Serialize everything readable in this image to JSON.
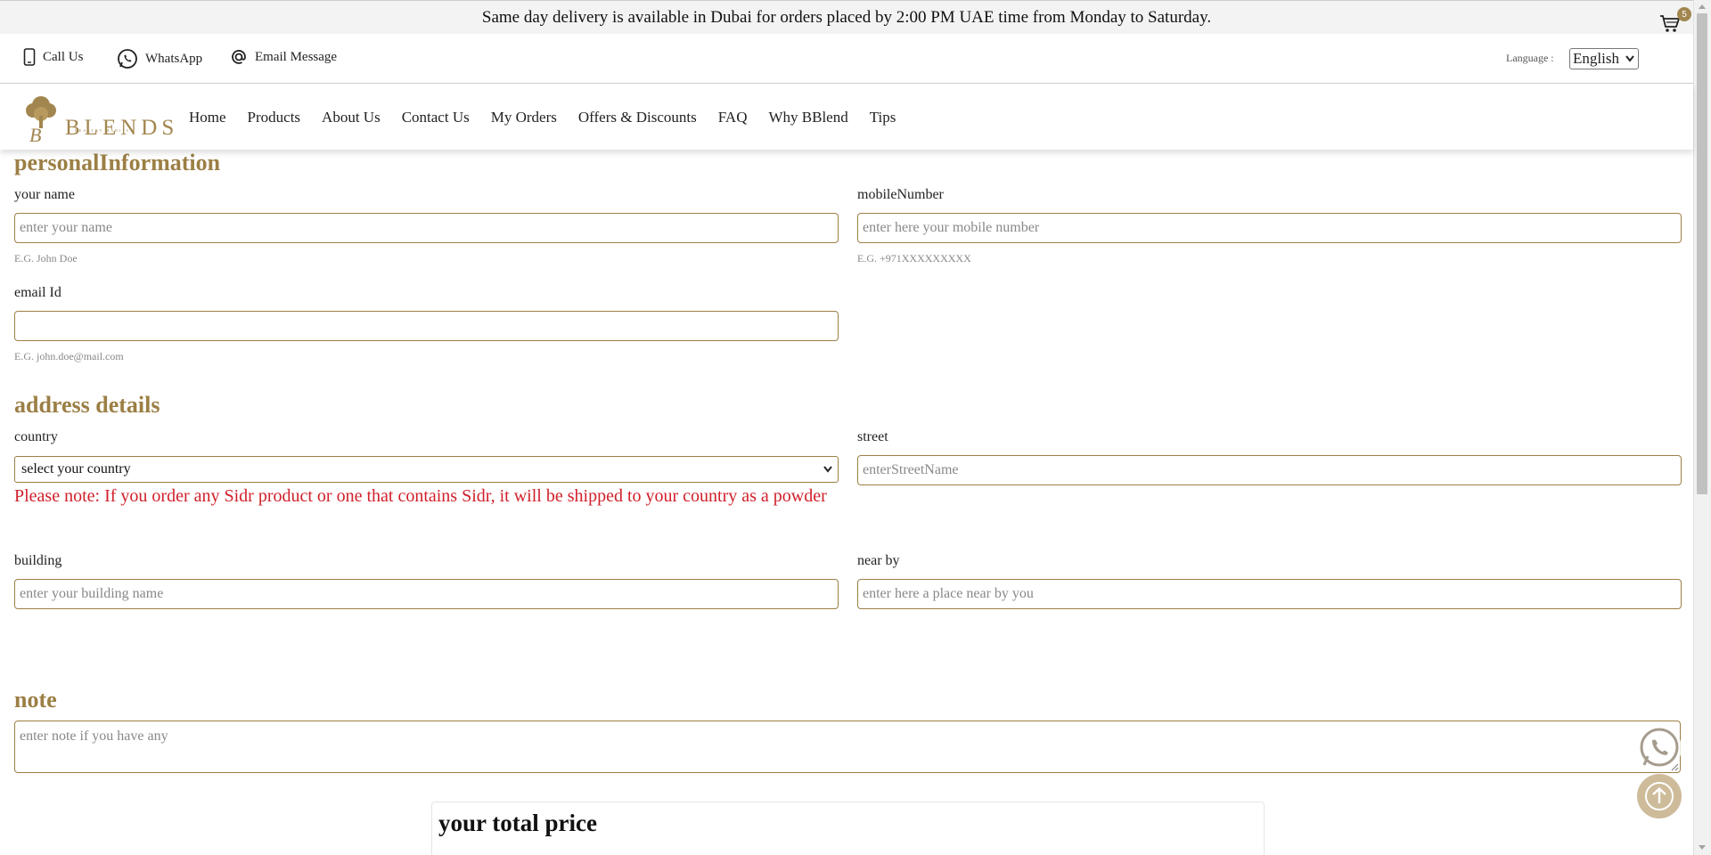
{
  "banner": {
    "text": "Same day delivery is available in Dubai for orders placed by 2:00 PM UAE time from Monday to Saturday."
  },
  "topbar": {
    "call": "Call Us",
    "whatsapp": "WhatsApp",
    "email": "Email Message",
    "language_label": "Language :",
    "language_value": "English",
    "cart_count": "5"
  },
  "logo": {
    "name": "BLENDS",
    "sub": "HEALTHY HABITS"
  },
  "nav": {
    "items": [
      "Home",
      "Products",
      "About Us",
      "Contact Us",
      "My Orders",
      "Offers & Discounts",
      "FAQ",
      "Why BBlend",
      "Tips"
    ]
  },
  "personal": {
    "title": "personalInformation",
    "name_label": "your name",
    "name_placeholder": "enter your name",
    "name_hint": "E.G. John Doe",
    "mobile_label": "mobileNumber",
    "mobile_placeholder": "enter here your mobile number",
    "mobile_hint": "E.G. +971XXXXXXXXX",
    "email_label": "email Id",
    "email_value": "",
    "email_hint": "E.G. john.doe@mail.com"
  },
  "address": {
    "title": "address details",
    "country_label": "country",
    "country_value": "select your country",
    "sidr_note": "Please note: If you order any Sidr product or one that contains Sidr, it will be shipped to your country as a powder",
    "street_label": "street",
    "street_placeholder": "enterStreetName",
    "building_label": "building",
    "building_placeholder": "enter your building name",
    "nearby_label": "near by",
    "nearby_placeholder": "enter here a place near by you"
  },
  "note": {
    "title": "note",
    "placeholder": "enter note if you have any"
  },
  "total": {
    "title": "your total price"
  },
  "colors": {
    "accent": "#9c7f45",
    "warning": "#d0202a",
    "fab": "#cdbb9a"
  }
}
